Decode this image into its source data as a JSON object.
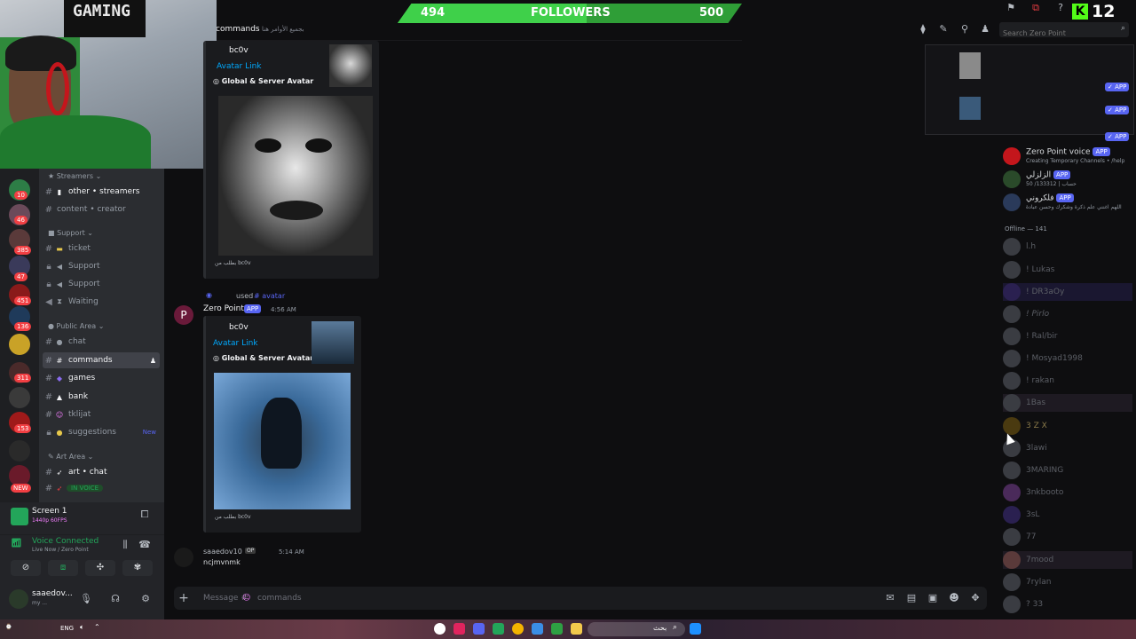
{
  "overlay": {
    "webcam_text": "GAMING",
    "followers": {
      "current": "494",
      "label": "FOLLOWERS",
      "goal": "500",
      "progress": 0.55
    },
    "kick_count": "12"
  },
  "header": {
    "channel": "commands",
    "topic": "بجميع الأوامر هنا",
    "search_placeholder": "Search Zero Point"
  },
  "sidebar": {
    "categories": {
      "streamers": "Streamers",
      "support": "Support",
      "public": "Public Area",
      "art": "Art Area"
    },
    "channels": {
      "other_streamers": "other • streamers",
      "content_creator": "content • creator",
      "ticket": "ticket",
      "support1": "Support",
      "support2": "Support",
      "waiting": "Waiting",
      "chat": "chat",
      "commands": "commands",
      "games": "games",
      "bank": "bank",
      "tklijat": "tklijat",
      "suggestions": "suggestions",
      "suggestions_badge": "New",
      "art_chat": "art • chat",
      "in_voice": "IN VOICE"
    },
    "server_badges": [
      "10",
      "46",
      "385",
      "47",
      "451",
      "136",
      "311",
      "153",
      "NEW"
    ]
  },
  "screen_panel": {
    "title": "Screen 1",
    "sub": "1440p 60FPS"
  },
  "voice_panel": {
    "status": "Voice Connected",
    "sub": "Live Now / Zero Point"
  },
  "user_panel": {
    "name": "saaedov...",
    "status": "my ..."
  },
  "messages": {
    "embed1": {
      "author": "bc0v",
      "link": "Avatar Link",
      "title": "Global & Server Avatar",
      "footer": "بطلب من bc0v"
    },
    "used_line": {
      "prefix": "used",
      "command": "# avatar"
    },
    "bot": {
      "name": "Zero Point",
      "tag": "APP",
      "time": "4:56 AM"
    },
    "embed2": {
      "author": "bc0v",
      "link": "Avatar Link",
      "title": "Global & Server Avatar",
      "footer": "بطلب من bc0v"
    },
    "user_msg": {
      "name": "saaedov10",
      "badge": "OP",
      "time": "5:14 AM",
      "text": "ncjmvnmk"
    }
  },
  "composer": {
    "placeholder": "Message #",
    "channel": "commands"
  },
  "members": {
    "online": [
      {
        "name": "Zero Point voice",
        "tag": "APP",
        "sub": "Creating Temporary Channels • /help"
      },
      {
        "name": "الزلزلي",
        "tag": "APP",
        "sub": "50 /133312 | حساب"
      },
      {
        "name": "فلكروني",
        "tag": "APP",
        "sub": "اللهم اغنني علم ذكرة وشكرك وحسن عبادة"
      }
    ],
    "offline_header": "Offline — 141",
    "offline": [
      "l.h",
      "! Lukas",
      "! DR3aOy",
      "! Pirlo",
      "! Ral/bir",
      "! Mosyad1998",
      "! rakan",
      "1Bas",
      "3 Z X",
      "3lawi",
      "3MARING",
      "3nkbooto",
      "3sL",
      "77",
      "7mood",
      "7rylan",
      "? 33"
    ]
  },
  "taskbar": {
    "lang": "ENG",
    "search": "بحث"
  },
  "colors": {
    "accent": "#5865f2",
    "follow": "#2f9e37",
    "kick": "#53fc18"
  }
}
